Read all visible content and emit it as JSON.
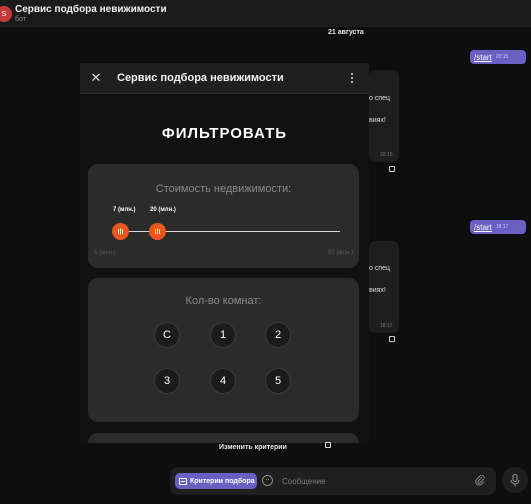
{
  "header": {
    "avatar_letter": "S",
    "title": "Сервис подбора невижимости",
    "subtitle": "бот"
  },
  "chat": {
    "date": "21 августа",
    "messages": [
      {
        "text": "/start",
        "time": "20:15"
      },
      {
        "text": "/start",
        "time": "18:17"
      }
    ],
    "incoming_fragments": [
      {
        "line1": "о спец",
        "line2": "виях!",
        "time": "20:15"
      },
      {
        "line1": "о спец",
        "line2": "виях!",
        "time": "18:17"
      }
    ]
  },
  "webapp": {
    "title": "Сервис подбора невижимости",
    "close_icon": "close-icon",
    "menu_icon": "more-vertical-icon",
    "heading": "ФИЛЬТРОВАТЬ",
    "price": {
      "title": "Стоимость недвижимости:",
      "min_selected": "7 (млн.)",
      "max_selected": "20 (млн.)",
      "range_min": "5 (млн.)",
      "range_max": "80 (млн.)"
    },
    "rooms": {
      "title": "Кол-во комнат:",
      "options": [
        "С",
        "1",
        "2",
        "3",
        "4",
        "5"
      ]
    }
  },
  "bottom": {
    "change_criteria": "Изменить критерии",
    "criteria_button": "Критерии подбора",
    "message_placeholder": "Сообщение"
  },
  "colors": {
    "accent": "#6b5fc4",
    "slider_thumb": "#e8571e",
    "background": "#0e0e0e",
    "card": "#2b2b2b"
  }
}
